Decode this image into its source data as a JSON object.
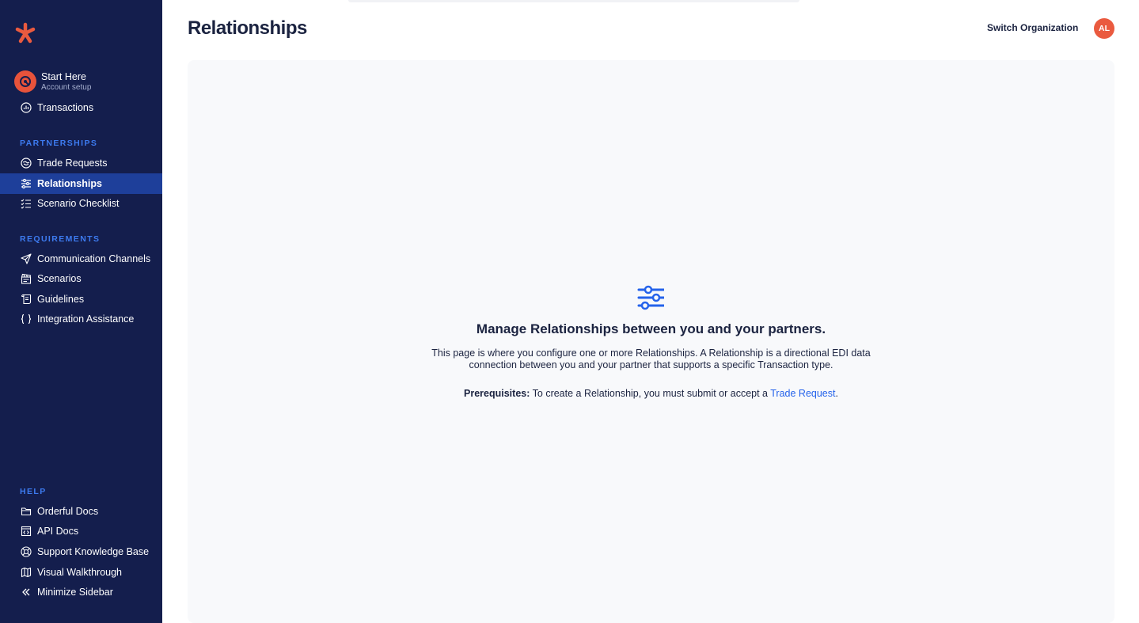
{
  "app": {
    "brand_color": "#ea5a3f",
    "sidebar_bg": "#141e4d",
    "accent": "#3d7bf0",
    "active_bg": "#1e3f9a"
  },
  "header": {
    "title": "Relationships",
    "switch_org": "Switch Organization",
    "avatar_initials": "AL"
  },
  "sidebar": {
    "start_here": {
      "title": "Start Here",
      "subtitle": "Account setup",
      "icon": "rocket-icon"
    },
    "transactions": {
      "label": "Transactions",
      "icon": "chart-icon"
    },
    "partnerships": {
      "label": "PARTNERSHIPS",
      "items": [
        {
          "label": "Trade Requests",
          "icon": "handshake-icon"
        },
        {
          "label": "Relationships",
          "icon": "sliders-icon",
          "active": true
        },
        {
          "label": "Scenario Checklist",
          "icon": "checklist-icon"
        }
      ]
    },
    "requirements": {
      "label": "REQUIREMENTS",
      "items": [
        {
          "label": "Communication Channels",
          "icon": "send-icon"
        },
        {
          "label": "Scenarios",
          "icon": "clapperboard-icon"
        },
        {
          "label": "Guidelines",
          "icon": "scroll-icon"
        },
        {
          "label": "Integration Assistance",
          "icon": "braces-icon"
        }
      ]
    },
    "help": {
      "label": "HELP",
      "items": [
        {
          "label": "Orderful Docs",
          "icon": "folder-icon"
        },
        {
          "label": "API Docs",
          "icon": "code-window-icon"
        },
        {
          "label": "Support Knowledge Base",
          "icon": "lifebuoy-icon"
        },
        {
          "label": "Visual Walkthrough",
          "icon": "map-icon"
        },
        {
          "label": "Minimize Sidebar",
          "icon": "double-chevron-left-icon"
        }
      ]
    }
  },
  "main": {
    "empty_title": "Manage Relationships between you and your partners.",
    "empty_desc": "This page is where you configure one or more Relationships. A Relationship is a directional EDI data connection between you and your partner that supports a specific Transaction type.",
    "prereq_label": "Prerequisites:",
    "prereq_text": " To create a Relationship, you must submit or accept a ",
    "prereq_link": "Trade Request",
    "prereq_end": "."
  }
}
